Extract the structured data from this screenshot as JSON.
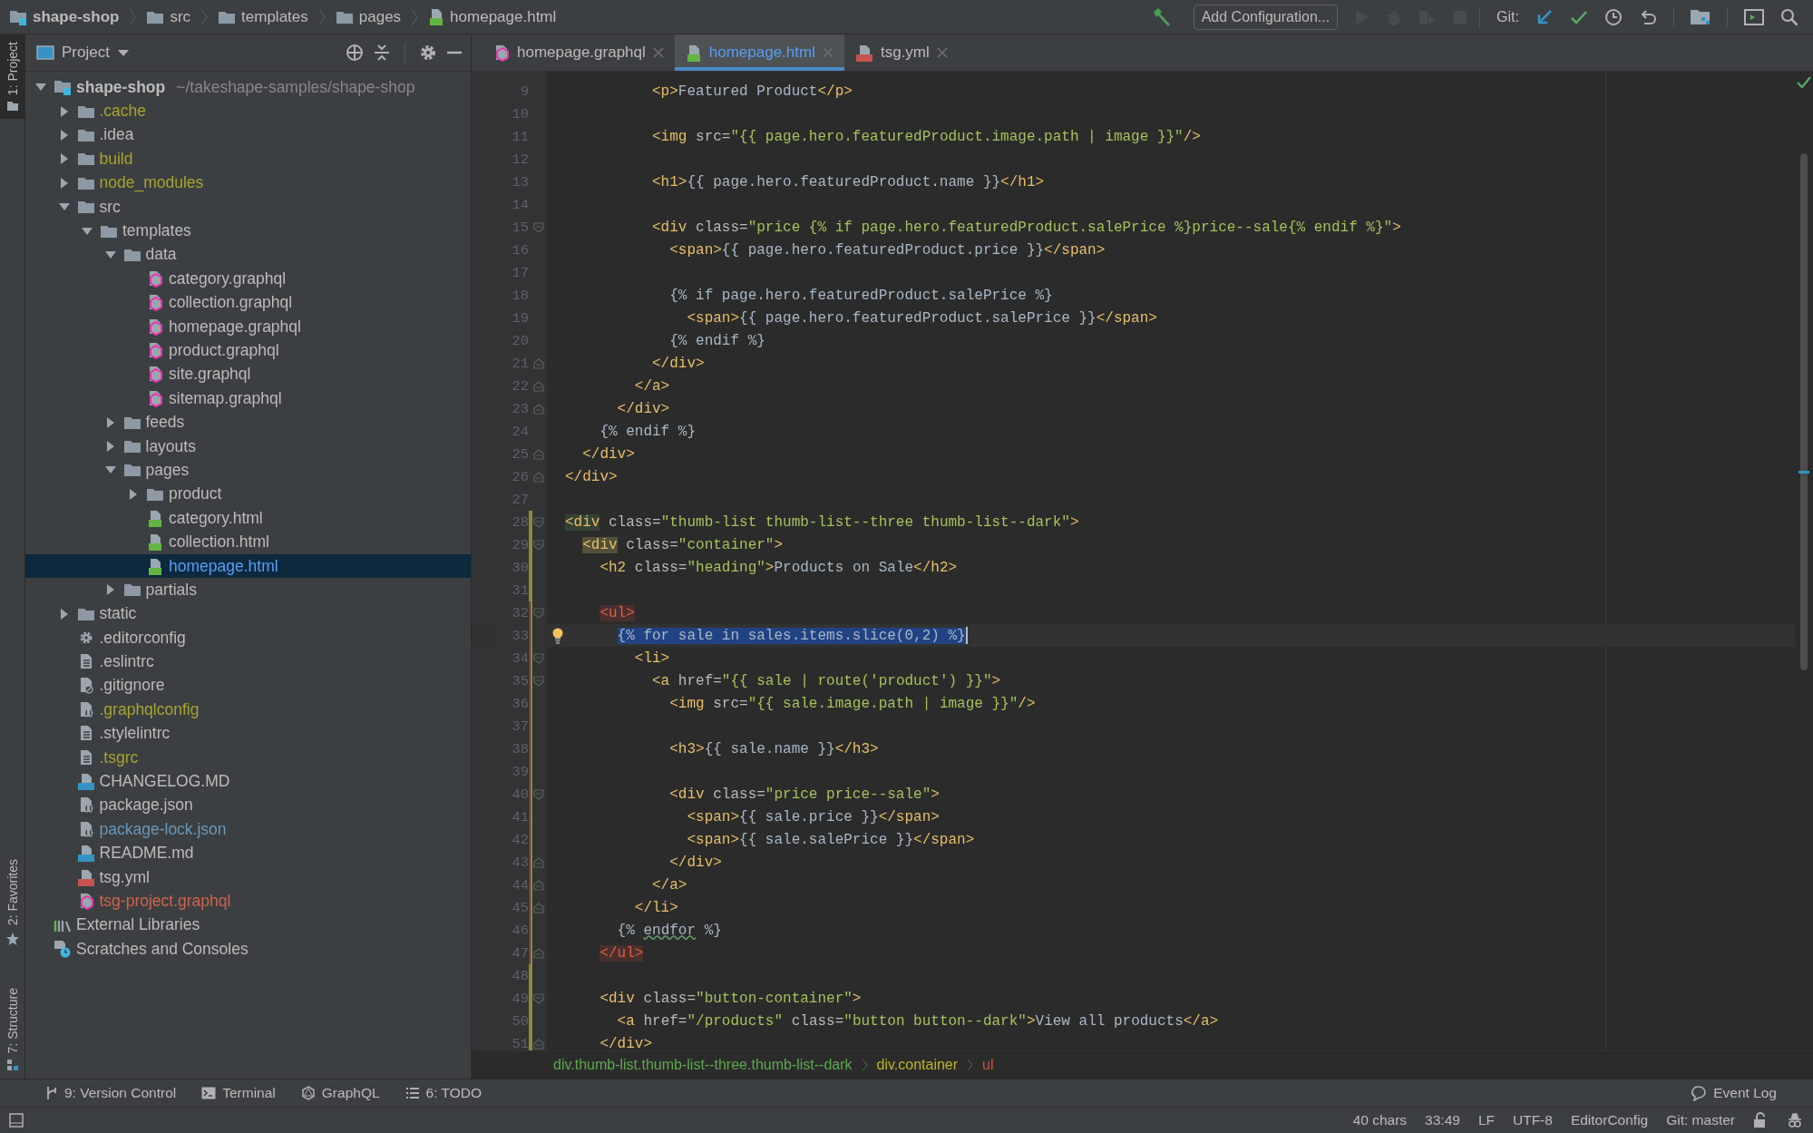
{
  "breadcrumb": [
    {
      "label": "shape-shop",
      "kind": "module"
    },
    {
      "label": "src",
      "kind": "folder"
    },
    {
      "label": "templates",
      "kind": "folder"
    },
    {
      "label": "pages",
      "kind": "folder"
    },
    {
      "label": "homepage.html",
      "kind": "html"
    }
  ],
  "toolbar": {
    "run_config": "Add Configuration...",
    "run_disabled": true,
    "git_label": "Git:"
  },
  "side_tabs": [
    {
      "label": "1: Project",
      "selected": true
    },
    {
      "label": "2: Favorites",
      "selected": false
    },
    {
      "label": "7: Structure",
      "selected": false
    }
  ],
  "project_panel": {
    "title": "Project"
  },
  "project_tree": [
    {
      "name": "shape-shop",
      "path": "~/takeshape-samples/shape-shop",
      "kind": "module",
      "expanded": true,
      "selected": false,
      "children": [
        {
          "name": ".cache",
          "kind": "folder",
          "expanded": false,
          "selected": false,
          "color": "#a8a32e"
        },
        {
          "name": ".idea",
          "kind": "folder",
          "expanded": false,
          "selected": false,
          "color": "#bbbbbb"
        },
        {
          "name": "build",
          "kind": "folder",
          "expanded": false,
          "selected": false,
          "color": "#a8a32e"
        },
        {
          "name": "node_modules",
          "kind": "folder",
          "expanded": false,
          "selected": false,
          "color": "#a8a32e"
        },
        {
          "name": "src",
          "kind": "folder",
          "expanded": true,
          "selected": false,
          "color": "#bbbbbb",
          "children": [
            {
              "name": "templates",
              "kind": "folder",
              "expanded": true,
              "selected": false,
              "color": "#bbbbbb",
              "children": [
                {
                  "name": "data",
                  "kind": "folder",
                  "expanded": true,
                  "selected": false,
                  "color": "#bbbbbb",
                  "children": [
                    {
                      "name": "category.graphql",
                      "kind": "graphql",
                      "selected": false,
                      "color": "#bbbbbb"
                    },
                    {
                      "name": "collection.graphql",
                      "kind": "graphql",
                      "selected": false,
                      "color": "#bbbbbb"
                    },
                    {
                      "name": "homepage.graphql",
                      "kind": "graphql",
                      "selected": false,
                      "color": "#bbbbbb"
                    },
                    {
                      "name": "product.graphql",
                      "kind": "graphql",
                      "selected": false,
                      "color": "#bbbbbb"
                    },
                    {
                      "name": "site.graphql",
                      "kind": "graphql",
                      "selected": false,
                      "color": "#bbbbbb"
                    },
                    {
                      "name": "sitemap.graphql",
                      "kind": "graphql",
                      "selected": false,
                      "color": "#bbbbbb"
                    }
                  ]
                },
                {
                  "name": "feeds",
                  "kind": "folder",
                  "expanded": false,
                  "selected": false,
                  "color": "#bbbbbb"
                },
                {
                  "name": "layouts",
                  "kind": "folder",
                  "expanded": false,
                  "selected": false,
                  "color": "#bbbbbb"
                },
                {
                  "name": "pages",
                  "kind": "folder",
                  "expanded": true,
                  "selected": false,
                  "color": "#bbbbbb",
                  "children": [
                    {
                      "name": "product",
                      "kind": "folder",
                      "expanded": false,
                      "selected": false,
                      "color": "#bbbbbb"
                    },
                    {
                      "name": "category.html",
                      "kind": "html",
                      "selected": false,
                      "color": "#bbbbbb"
                    },
                    {
                      "name": "collection.html",
                      "kind": "html",
                      "selected": false,
                      "color": "#bbbbbb"
                    },
                    {
                      "name": "homepage.html",
                      "kind": "html",
                      "selected": true,
                      "color": "#589df6"
                    }
                  ]
                },
                {
                  "name": "partials",
                  "kind": "folder",
                  "expanded": false,
                  "selected": false,
                  "color": "#bbbbbb"
                }
              ]
            }
          ]
        },
        {
          "name": "static",
          "kind": "folder",
          "expanded": false,
          "selected": false,
          "color": "#bbbbbb"
        },
        {
          "name": ".editorconfig",
          "kind": "settings",
          "selected": false,
          "color": "#bbbbbb"
        },
        {
          "name": ".eslintrc",
          "kind": "text",
          "selected": false,
          "color": "#bbbbbb"
        },
        {
          "name": ".gitignore",
          "kind": "ignore",
          "selected": false,
          "color": "#bbbbbb"
        },
        {
          "name": ".graphqlconfig",
          "kind": "json",
          "selected": false,
          "color": "#a8a32e"
        },
        {
          "name": ".stylelintrc",
          "kind": "text",
          "selected": false,
          "color": "#bbbbbb"
        },
        {
          "name": ".tsgrc",
          "kind": "text",
          "selected": false,
          "color": "#a8a32e"
        },
        {
          "name": "CHANGELOG.MD",
          "kind": "md",
          "selected": false,
          "color": "#bbbbbb"
        },
        {
          "name": "package.json",
          "kind": "json",
          "selected": false,
          "color": "#bbbbbb"
        },
        {
          "name": "package-lock.json",
          "kind": "json",
          "selected": false,
          "color": "#6897bb"
        },
        {
          "name": "README.md",
          "kind": "md",
          "selected": false,
          "color": "#bbbbbb"
        },
        {
          "name": "tsg.yml",
          "kind": "yml",
          "selected": false,
          "color": "#bbbbbb"
        },
        {
          "name": "tsg-project.graphql",
          "kind": "graphql",
          "selected": false,
          "color": "#d0634f"
        }
      ]
    },
    {
      "name": "External Libraries",
      "kind": "libraries",
      "selected": false,
      "color": "#bbbbbb"
    },
    {
      "name": "Scratches and Consoles",
      "kind": "scratches",
      "selected": false,
      "color": "#bbbbbb"
    }
  ],
  "tabs": [
    {
      "label": "homepage.graphql",
      "kind": "graphql",
      "selected": false
    },
    {
      "label": "homepage.html",
      "kind": "html",
      "selected": true
    },
    {
      "label": "tsg.yml",
      "kind": "yml",
      "selected": false
    }
  ],
  "code_lines": [
    {
      "number": "9",
      "kind": "plain",
      "code": "          <p>Featured Product</p>",
      "fold_start": false,
      "fold_end": false,
      "added": false,
      "modified": false
    },
    {
      "number": "10",
      "kind": "plain",
      "fold_start": false,
      "fold_end": false,
      "added": false,
      "modified": false
    },
    {
      "number": "11",
      "kind": "plain",
      "code": "          <img src=\"{{ page.hero.featuredProduct.image.path | image }}\"/>",
      "fold_start": false,
      "fold_end": false,
      "added": false,
      "modified": false
    },
    {
      "number": "12",
      "kind": "plain",
      "fold_start": false,
      "fold_end": false,
      "added": false,
      "modified": false
    },
    {
      "number": "13",
      "kind": "plain",
      "code": "          <h1>{{ page.hero.featuredProduct.name }}</h1>",
      "fold_start": false,
      "fold_end": false,
      "added": false,
      "modified": false
    },
    {
      "number": "14",
      "kind": "plain",
      "fold_start": false,
      "fold_end": false,
      "added": false,
      "modified": false
    },
    {
      "number": "15",
      "kind": "plain",
      "code": "          <div class=\"price {% if page.hero.featuredProduct.salePrice %}price--sale{% endif %}\">",
      "fold_start": true,
      "fold_end": false,
      "added": false,
      "modified": false
    },
    {
      "number": "16",
      "kind": "plain",
      "code": "            <span>{{ page.hero.featuredProduct.price }}</span>",
      "fold_start": false,
      "fold_end": false,
      "added": false,
      "modified": false
    },
    {
      "number": "17",
      "kind": "plain",
      "fold_start": false,
      "fold_end": false,
      "added": false,
      "modified": false
    },
    {
      "number": "18",
      "kind": "plain",
      "code": "            {% if page.hero.featuredProduct.salePrice %}",
      "fold_start": false,
      "fold_end": false,
      "added": false,
      "modified": false
    },
    {
      "number": "19",
      "kind": "plain",
      "code": "              <span>{{ page.hero.featuredProduct.salePrice }}</span>",
      "fold_start": false,
      "fold_end": false,
      "added": false,
      "modified": false
    },
    {
      "number": "20",
      "kind": "plain",
      "code": "            {% endif %}",
      "fold_start": false,
      "fold_end": false,
      "added": false,
      "modified": false
    },
    {
      "number": "21",
      "kind": "plain",
      "code": "          </div>",
      "fold_start": false,
      "fold_end": true,
      "added": false,
      "modified": false
    },
    {
      "number": "22",
      "kind": "plain",
      "code": "        </a>",
      "fold_start": false,
      "fold_end": true,
      "added": false,
      "modified": false
    },
    {
      "number": "23",
      "kind": "plain",
      "code": "      </div>",
      "fold_start": false,
      "fold_end": true,
      "added": false,
      "modified": false
    },
    {
      "number": "24",
      "kind": "plain",
      "code": "    {% endif %}",
      "fold_start": false,
      "fold_end": false,
      "added": false,
      "modified": false
    },
    {
      "number": "25",
      "kind": "plain",
      "code": "  </div>",
      "fold_start": false,
      "fold_end": true,
      "added": false,
      "modified": false
    },
    {
      "number": "26",
      "kind": "plain",
      "code": "</div>",
      "fold_start": false,
      "fold_end": true,
      "added": false,
      "modified": false
    },
    {
      "number": "27",
      "kind": "plain",
      "fold_start": false,
      "fold_end": false,
      "added": false,
      "modified": false
    },
    {
      "number": "28",
      "kind": "matched",
      "code": "<div class=\"thumb-list thumb-list--three thumb-list--dark\">",
      "fold_start": true,
      "fold_end": false,
      "added": true,
      "modified": false
    },
    {
      "number": "29",
      "kind": "matched",
      "code": "  <div class=\"container\">",
      "fold_start": true,
      "fold_end": false,
      "added": true,
      "modified": false
    },
    {
      "number": "30",
      "kind": "plain",
      "code": "    <h2 class=\"heading\">Products on Sale</h2>",
      "fold_start": false,
      "fold_end": false,
      "added": true,
      "modified": false
    },
    {
      "number": "31",
      "kind": "plain",
      "fold_start": false,
      "fold_end": false,
      "added": true,
      "modified": false
    },
    {
      "number": "32",
      "kind": "unmatched",
      "code": "    <ul>",
      "fold_start": true,
      "fold_end": false,
      "added": true,
      "modified": true
    },
    {
      "number": "33",
      "kind": "selection",
      "code": "      {% for sale in sales.items.slice(0,2) %}",
      "fold_start": false,
      "fold_end": false,
      "added": true,
      "modified": true
    },
    {
      "number": "34",
      "kind": "plain",
      "code": "        <li>",
      "fold_start": true,
      "fold_end": false,
      "added": true,
      "modified": true
    },
    {
      "number": "35",
      "kind": "plain",
      "code": "          <a href=\"{{ sale | route('product') }}\">",
      "fold_start": true,
      "fold_end": false,
      "added": true,
      "modified": true
    },
    {
      "number": "36",
      "kind": "plain",
      "code": "            <img src=\"{{ sale.image.path | image }}\"/>",
      "fold_start": false,
      "fold_end": false,
      "added": true,
      "modified": true
    },
    {
      "number": "37",
      "kind": "plain",
      "fold_start": false,
      "fold_end": false,
      "added": true,
      "modified": true
    },
    {
      "number": "38",
      "kind": "plain",
      "code": "            <h3>{{ sale.name }}</h3>",
      "fold_start": false,
      "fold_end": false,
      "added": true,
      "modified": true
    },
    {
      "number": "39",
      "kind": "plain",
      "fold_start": false,
      "fold_end": false,
      "added": true,
      "modified": true
    },
    {
      "number": "40",
      "kind": "plain",
      "code": "            <div class=\"price price--sale\">",
      "fold_start": true,
      "fold_end": false,
      "added": true,
      "modified": true
    },
    {
      "number": "41",
      "kind": "plain",
      "code": "              <span>{{ sale.price }}</span>",
      "fold_start": false,
      "fold_end": false,
      "added": true,
      "modified": true
    },
    {
      "number": "42",
      "kind": "plain",
      "code": "              <span>{{ sale.salePrice }}</span>",
      "fold_start": false,
      "fold_end": false,
      "added": true,
      "modified": true
    },
    {
      "number": "43",
      "kind": "plain",
      "code": "            </div>",
      "fold_start": false,
      "fold_end": true,
      "added": true,
      "modified": true
    },
    {
      "number": "44",
      "kind": "plain",
      "code": "          </a>",
      "fold_start": false,
      "fold_end": true,
      "added": true,
      "modified": true
    },
    {
      "number": "45",
      "kind": "plain",
      "code": "        </li>",
      "fold_start": false,
      "fold_end": true,
      "added": true,
      "modified": true
    },
    {
      "number": "46",
      "kind": "misspelled",
      "code": "      {% endfor %}",
      "fold_start": false,
      "fold_end": false,
      "added": true,
      "modified": true
    },
    {
      "number": "47",
      "kind": "unmatched",
      "code": "    </ul>",
      "fold_start": false,
      "fold_end": true,
      "added": true,
      "modified": true
    },
    {
      "number": "48",
      "kind": "plain",
      "fold_start": false,
      "fold_end": false,
      "added": true,
      "modified": false
    },
    {
      "number": "49",
      "kind": "plain",
      "code": "    <div class=\"button-container\">",
      "fold_start": true,
      "fold_end": false,
      "added": true,
      "modified": false
    },
    {
      "number": "50",
      "kind": "plain",
      "code": "      <a href=\"/products\" class=\"button button--dark\">View all products</a>",
      "fold_start": false,
      "fold_end": false,
      "added": true,
      "modified": false
    },
    {
      "number": "51",
      "kind": "plain",
      "code": "    </div>",
      "fold_start": false,
      "fold_end": true,
      "added": true,
      "modified": false
    }
  ],
  "code_path": [
    {
      "label": "div.thumb-list.thumb-list--three.thumb-list--dark",
      "color": "#5fa84f"
    },
    {
      "label": "div.container",
      "color": "#bbb529"
    },
    {
      "label": "ul",
      "color": "#c7553f"
    }
  ],
  "tool_windows": [
    {
      "label": "9: Version Control",
      "kind": "vcs"
    },
    {
      "label": "Terminal",
      "kind": "terminal"
    },
    {
      "label": "GraphQL",
      "kind": "graphql"
    },
    {
      "label": "6: TODO",
      "kind": "todo"
    }
  ],
  "event_log": "Event Log",
  "status_bar": [
    "40 chars",
    "33:49",
    "LF",
    "UTF-8",
    "EditorConfig",
    "Git: master"
  ]
}
